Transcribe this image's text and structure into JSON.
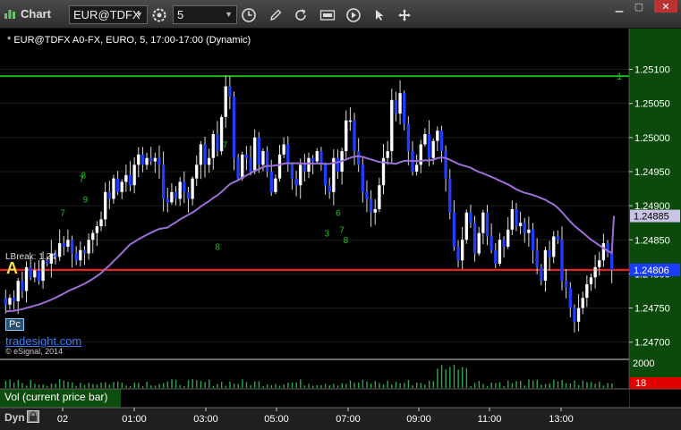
{
  "window": {
    "title": "Chart",
    "symbol": "EUR@TDFX",
    "period": "5"
  },
  "toolbar": {
    "icons": [
      "settings-icon",
      "clock-icon",
      "pencil-icon",
      "refresh-icon",
      "cot-icon",
      "play-icon",
      "move-icon"
    ]
  },
  "chart": {
    "description": "* EUR@TDFX A0-FX, EURO, 5, 17:00-17:00 (Dynamic)",
    "brand": "tradesight.com",
    "copyright": "© eSignal, 2014",
    "volume_label": "Vol (current price bar)",
    "dyn_label": "Dyn",
    "pc_label": "Pc",
    "a_label": "A",
    "lbreak_label": "LBreak: 1.24",
    "price_ticks": [
      "1.25100",
      "1.25050",
      "1.25000",
      "1.24950",
      "1.24900",
      "1.24850",
      "1.24800",
      "1.24750",
      "1.24700"
    ],
    "time_ticks": [
      "02",
      "01:00",
      "03:00",
      "05:00",
      "07:00",
      "09:00",
      "11:00",
      "13:00"
    ],
    "volume_tick": "2000",
    "current_volume": "18",
    "ma_value": "1.24885",
    "current_price": "1.24806",
    "green_line_marker": "1",
    "colors": {
      "up_bar": "#ffffff",
      "down_bar": "#1f3dff",
      "moving_average": "#9b6fd6",
      "green_line": "#1db81d",
      "red_line": "#ff2020",
      "price_axis_bg": "#0b4a0b",
      "volume_bar": "#2ea84a"
    }
  },
  "chart_data": {
    "type": "candlestick",
    "title": "* EUR@TDFX A0-FX, EURO, 5, 17:00-17:00 (Dynamic)",
    "ylim": [
      1.2468,
      1.2514
    ],
    "horizontal_lines": [
      {
        "label": "green",
        "value": 1.2509
      },
      {
        "label": "red",
        "value": 1.24806
      }
    ],
    "moving_average_end": 1.24885,
    "last_price": 1.24806,
    "x_ticks": [
      "02",
      "01:00",
      "03:00",
      "05:00",
      "07:00",
      "09:00",
      "11:00",
      "13:00"
    ],
    "close_series": [
      1.24755,
      1.24765,
      1.2476,
      1.2479,
      1.24775,
      1.2481,
      1.24795,
      1.24805,
      1.2479,
      1.2482,
      1.24815,
      1.2483,
      1.24825,
      1.24845,
      1.2484,
      1.2485,
      1.2483,
      1.2482,
      1.24835,
      1.2483,
      1.2485,
      1.2486,
      1.2487,
      1.2488,
      1.2492,
      1.2491,
      1.2494,
      1.2492,
      1.24935,
      1.24945,
      1.2493,
      1.2496,
      1.24975,
      1.2496,
      1.2497,
      1.24965,
      1.2497,
      1.2496,
      1.2491,
      1.24905,
      1.2492,
      1.2491,
      1.24935,
      1.2492,
      1.2491,
      1.2494,
      1.2496,
      1.2499,
      1.2496,
      1.2497,
      1.25005,
      1.2498,
      1.2503,
      1.25075,
      1.2506,
      1.2497,
      1.2494,
      1.24975,
      1.2497,
      1.2495,
      1.25,
      1.2496,
      1.2498,
      1.2495,
      1.2492,
      1.2494,
      1.24975,
      1.2499,
      1.2496,
      1.2494,
      1.2493,
      1.2496,
      1.2495,
      1.2497,
      1.24965,
      1.2498,
      1.2496,
      1.2493,
      1.2492,
      1.2497,
      1.2495,
      1.2498,
      1.25025,
      1.25025,
      1.2498,
      1.2496,
      1.2492,
      1.2491,
      1.2489,
      1.24895,
      1.2493,
      1.2497,
      1.2498,
      1.25055,
      1.25035,
      1.25065,
      1.2502,
      1.2498,
      1.2495,
      1.2496,
      1.2499,
      1.25005,
      1.2497,
      1.24995,
      1.2501,
      1.2498,
      1.2494,
      1.2489,
      1.2484,
      1.2482,
      1.2485,
      1.2489,
      1.24875,
      1.2483,
      1.2486,
      1.2489,
      1.24855,
      1.24835,
      1.24815,
      1.2485,
      1.2484,
      1.24865,
      1.24895,
      1.2487,
      1.24875,
      1.2486,
      1.24865,
      1.24835,
      1.2481,
      1.2479,
      1.24835,
      1.24825,
      1.24855,
      1.2485,
      1.2479,
      1.2478,
      1.2475,
      1.2473,
      1.2475,
      1.24765,
      1.24785,
      1.24795,
      1.2481,
      1.2482,
      1.24845,
      1.2483,
      1.24806
    ]
  }
}
